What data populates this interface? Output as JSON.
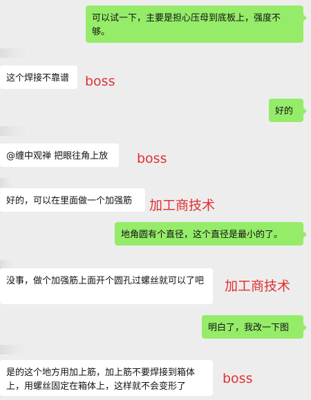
{
  "messages": [
    {
      "dir": "out",
      "text": "可以试一下，主要是担心压母到底板上，强度不够。"
    },
    {
      "dir": "in",
      "text": "这个焊接不靠谱",
      "tag": "boss"
    },
    {
      "dir": "out",
      "text": "好的"
    },
    {
      "dir": "in",
      "text": "@缠中观禅 把眼往角上放",
      "tag": "boss"
    },
    {
      "dir": "in",
      "text": "好的，可以在里面做一个加强筋",
      "tag": "加工商技术"
    },
    {
      "dir": "out",
      "text": "地角圆有个直径，这个直径是最小的了。"
    },
    {
      "dir": "in",
      "text": "没事，做个加强筋上面开个圆孔过螺丝就可以了吧",
      "tag": "加工商技术"
    },
    {
      "dir": "out",
      "text": "明白了，我改一下图"
    },
    {
      "dir": "in",
      "text": "是的这个地方用加上筋，加上筋不要焊接到箱体上，用螺丝固定在箱体上，这样就不会变形了",
      "tag": "boss"
    }
  ]
}
